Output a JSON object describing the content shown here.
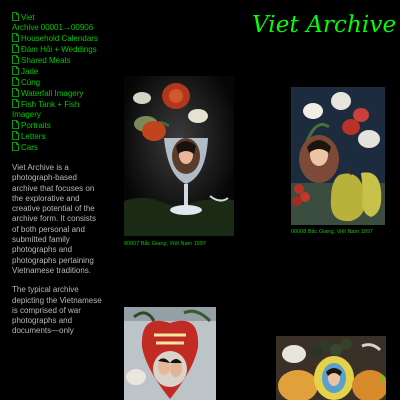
{
  "sidebar": {
    "nav": [
      {
        "label": "Viet Archive",
        "counter": "00001→00906",
        "icon": "document-icon"
      },
      {
        "label": "Household Calendars",
        "icon": "document-icon"
      },
      {
        "label": "Đám Hỏi + Weddings",
        "icon": "document-icon"
      },
      {
        "label": "Shared Meals",
        "icon": "document-icon"
      },
      {
        "label": "Jade",
        "icon": "document-icon"
      },
      {
        "label": "Cúng",
        "icon": "document-icon"
      },
      {
        "label": "Waterfall Imagery",
        "icon": "document-icon"
      },
      {
        "label": "Fish Tank + Fish Imagery",
        "icon": "document-icon"
      },
      {
        "label": "Portraits",
        "icon": "document-icon"
      },
      {
        "label": "Letters",
        "icon": "document-icon"
      },
      {
        "label": "Cars",
        "icon": "document-icon"
      }
    ],
    "about": [
      "Viet Archive is a photograph-based archive that focuses on the explorative and creative potential of the archive form. It consists of both personal and submitted family photographs and photographs pertaining Vietnamese traditions.",
      "The typical archive depicting the Vietnamese is comprised of war photographs and documents—only"
    ]
  },
  "header": {
    "title": "Viet Archive"
  },
  "gallery": [
    {
      "caption": "00007 Bắc Giang, Việt Nam 1997"
    },
    {
      "caption": "00008 Bắc Giang, Việt Nam 1997"
    },
    {
      "caption": ""
    },
    {
      "caption": ""
    }
  ],
  "scroll_top": {
    "icon": "arrow-up-icon",
    "glyph": "⇡"
  },
  "colors": {
    "background": "#000000",
    "accent": "#00ff00",
    "nav_text": "#00c800",
    "body_text": "#b8b8b8"
  }
}
